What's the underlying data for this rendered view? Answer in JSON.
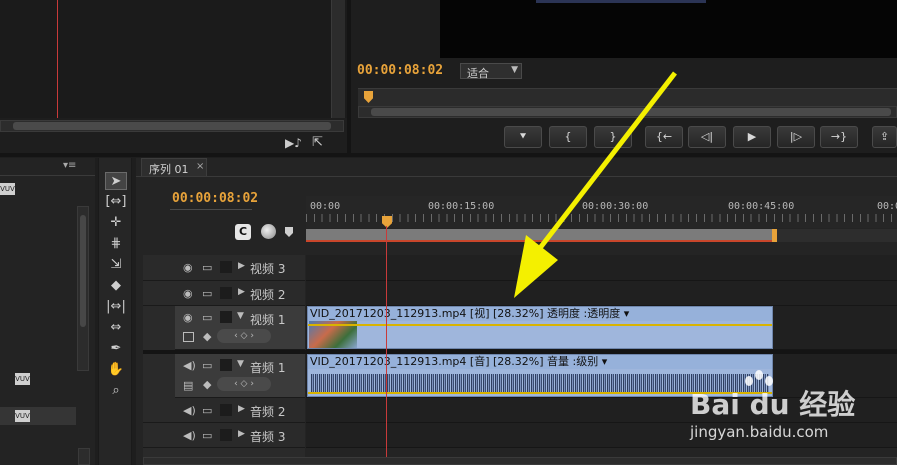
{
  "program_monitor": {
    "timecode": "00:00:08:02",
    "fit_select": "适合",
    "controls": [
      "⯆",
      "{",
      "}",
      "{←",
      "◁|",
      "▶",
      "|▷",
      "→}"
    ]
  },
  "sequence": {
    "tab_label": "序列 01",
    "tab_close": "×",
    "timecode": "00:00:08:02",
    "ruler": [
      "00:00",
      "00:00:15:00",
      "00:00:30:00",
      "00:00:45:00",
      "00:0"
    ]
  },
  "tracks": {
    "video3": "视频 3",
    "video2": "视频 2",
    "video1": "视频 1",
    "audio1": "音频 1",
    "audio2": "音频 2",
    "audio3": "音频 3"
  },
  "clips": {
    "video": "VID_20171203_112913.mp4  [视]  [28.32%]  透明度 :透明度 ▾",
    "audio": "VID_20171203_112913.mp4  [音]  [28.32%]  音量 :级别 ▾"
  },
  "watermark": {
    "brand": "Bai du 经验",
    "url": "jingyan.baidu.com"
  },
  "colors": {
    "accent": "#e8a33a",
    "playhead": "#c83a3a",
    "clip": "#96b1da",
    "arrow": "#f4f000"
  },
  "icons": {
    "eye": "👁",
    "speaker": "🔈",
    "selection": "➤",
    "magnifier": "🔍",
    "hand": "✋",
    "pen": "✒"
  }
}
